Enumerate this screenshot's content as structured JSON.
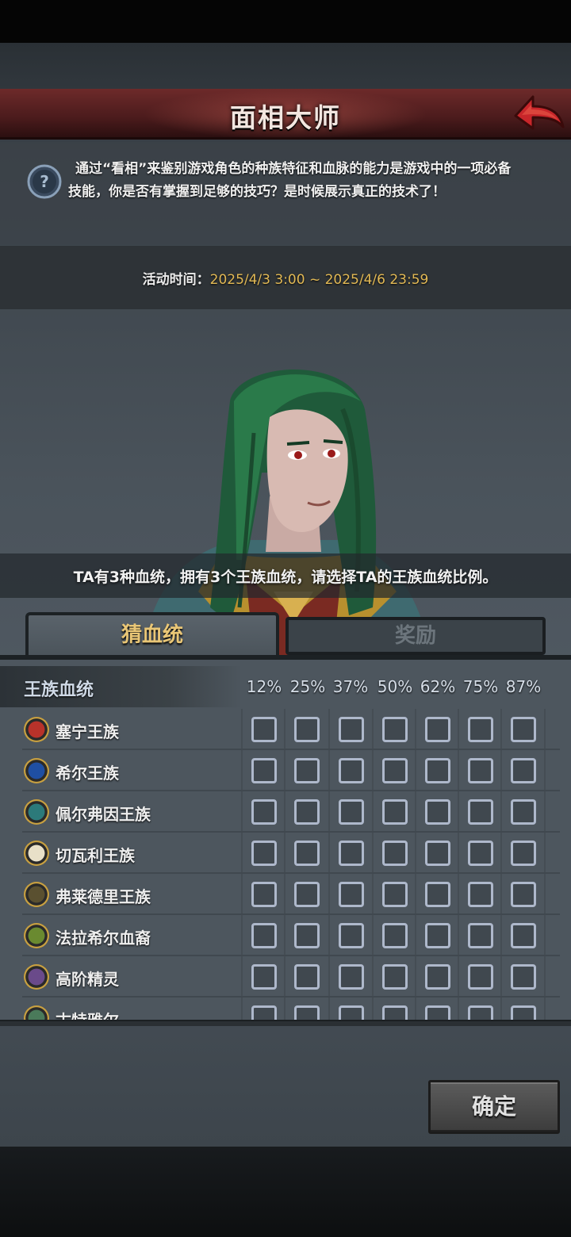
{
  "header": {
    "title": "面相大师"
  },
  "description": {
    "text": "通过“看相”来鉴别游戏角色的种族特征和血脉的能力是游戏中的一项必备技能，你是否有掌握到足够的技巧？是时候展示真正的技术了！"
  },
  "event_time": {
    "label": "活动时间：",
    "value": "2025/4/3 3:00 ~ 2025/4/6 23:59"
  },
  "hint": "TA有3种血统，拥有3个王族血统，请选择TA的王族血统比例。",
  "tabs": [
    {
      "label": "猜血统",
      "active": true
    },
    {
      "label": "奖励",
      "active": false
    }
  ],
  "table": {
    "header_label": "王族血统",
    "percentages": [
      "12%",
      "25%",
      "37%",
      "50%",
      "62%",
      "75%",
      "87%"
    ],
    "rows": [
      {
        "name": "塞宁王族",
        "icon": "red-sun-crest-icon",
        "icon_color": "#b8322a"
      },
      {
        "name": "希尔王族",
        "icon": "blue-bear-crest-icon",
        "icon_color": "#1f4fa3"
      },
      {
        "name": "佩尔弗因王族",
        "icon": "teal-tower-crest-icon",
        "icon_color": "#2c7a7a"
      },
      {
        "name": "切瓦利王族",
        "icon": "scales-crest-icon",
        "icon_color": "#e8e0c8"
      },
      {
        "name": "弗莱德里王族",
        "icon": "skull-crest-icon",
        "icon_color": "#5a5030"
      },
      {
        "name": "法拉希尔血裔",
        "icon": "tree-crest-icon",
        "icon_color": "#6a8a30"
      },
      {
        "name": "高阶精灵",
        "icon": "elf-eye-crest-icon",
        "icon_color": "#6a4a8a"
      },
      {
        "name": "古特雅尔",
        "icon": "rune-crest-icon",
        "icon_color": "#4a7a5a"
      }
    ]
  },
  "confirm_label": "确定",
  "colors": {
    "accent_gold": "#e2b955",
    "header_red": "#6d2a2a",
    "back_arrow_red": "#c8262a"
  }
}
